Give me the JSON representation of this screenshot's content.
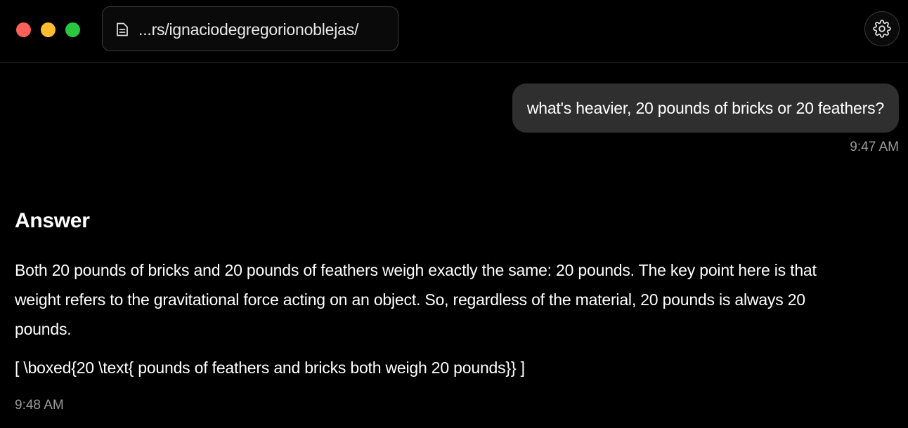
{
  "window": {
    "traffic_lights": [
      "close",
      "minimize",
      "maximize"
    ],
    "colors": {
      "close": "#fe5f57",
      "minimize": "#febc2e",
      "maximize": "#28c840"
    }
  },
  "address_bar": {
    "icon": "document-icon",
    "url": "...rs/ignaciodegregorionoblejas/"
  },
  "settings": {
    "icon": "gear-icon"
  },
  "conversation": {
    "user_message": {
      "text": "what's heavier, 20 pounds of bricks or 20 feathers?",
      "time": "9:47 AM"
    },
    "assistant_message": {
      "heading": "Answer",
      "paragraph": "Both 20 pounds of bricks and 20 pounds of feathers weigh exactly the same: 20 pounds. The key point here is that weight refers to the gravitational force acting on an object. So, regardless of the material, 20 pounds is always 20 pounds.",
      "formula": "[ \\boxed{20 \\text{ pounds of feathers and bricks both weigh 20 pounds}} ]",
      "time": "9:48 AM"
    }
  },
  "theme": {
    "background": "#000000",
    "bubble": "#2f2f2f",
    "muted_text": "#9a9a9a"
  }
}
